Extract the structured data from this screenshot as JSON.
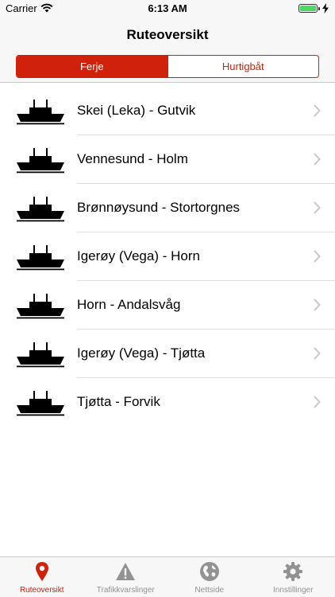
{
  "status_bar": {
    "carrier": "Carrier",
    "time": "6:13 AM"
  },
  "nav": {
    "title": "Ruteoversikt"
  },
  "segments": [
    {
      "label": "Ferje",
      "selected": true
    },
    {
      "label": "Hurtigbåt",
      "selected": false
    }
  ],
  "routes": [
    {
      "label": "Skei (Leka) - Gutvik",
      "icon": "ferry-icon"
    },
    {
      "label": "Vennesund - Holm",
      "icon": "ferry-icon"
    },
    {
      "label": "Brønnøysund - Stortorgnes",
      "icon": "ferry-icon"
    },
    {
      "label": "Igerøy (Vega) - Horn",
      "icon": "ferry-icon"
    },
    {
      "label": "Horn - Andalsvåg",
      "icon": "ferry-icon"
    },
    {
      "label": "Igerøy (Vega) - Tjøtta",
      "icon": "ferry-icon"
    },
    {
      "label": "Tjøtta - Forvik",
      "icon": "ferry-icon"
    }
  ],
  "tabs": [
    {
      "label": "Ruteoversikt",
      "icon": "location-pin-icon",
      "active": true
    },
    {
      "label": "Trafikkvarslinger",
      "icon": "warning-icon",
      "active": false
    },
    {
      "label": "Nettside",
      "icon": "globe-icon",
      "active": false
    },
    {
      "label": "Innstillinger",
      "icon": "gear-icon",
      "active": false
    }
  ],
  "colors": {
    "accent": "#d0210b",
    "inactive": "#929292",
    "battery": "#4cd964"
  }
}
